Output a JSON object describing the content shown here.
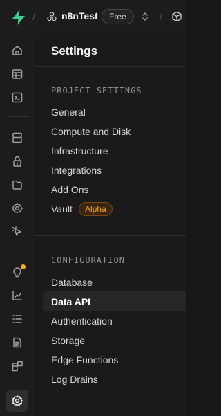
{
  "header": {
    "project_name": "n8nTest",
    "plan_badge": "Free"
  },
  "settings": {
    "title": "Settings",
    "project_section_label": "PROJECT SETTINGS",
    "project_items": [
      "General",
      "Compute and Disk",
      "Infrastructure",
      "Integrations",
      "Add Ons",
      "Vault"
    ],
    "vault_badge": "Alpha",
    "config_section_label": "CONFIGURATION",
    "config_items": [
      "Database",
      "Data API",
      "Authentication",
      "Storage",
      "Edge Functions",
      "Log Drains"
    ],
    "active_item": "Data API"
  },
  "rail": {
    "icons": [
      "home-icon",
      "table-editor-icon",
      "sql-editor-icon",
      "database-icon",
      "authentication-icon",
      "storage-icon",
      "realtime-icon",
      "edge-functions-icon",
      "advisors-icon",
      "reports-icon",
      "logs-icon",
      "api-docs-icon",
      "integrations-icon",
      "settings-icon"
    ],
    "active_icon": "settings-icon"
  },
  "colors": {
    "brand_green": "#3ecf8e",
    "alpha_badge": "#f5a623",
    "background": "#171717"
  }
}
